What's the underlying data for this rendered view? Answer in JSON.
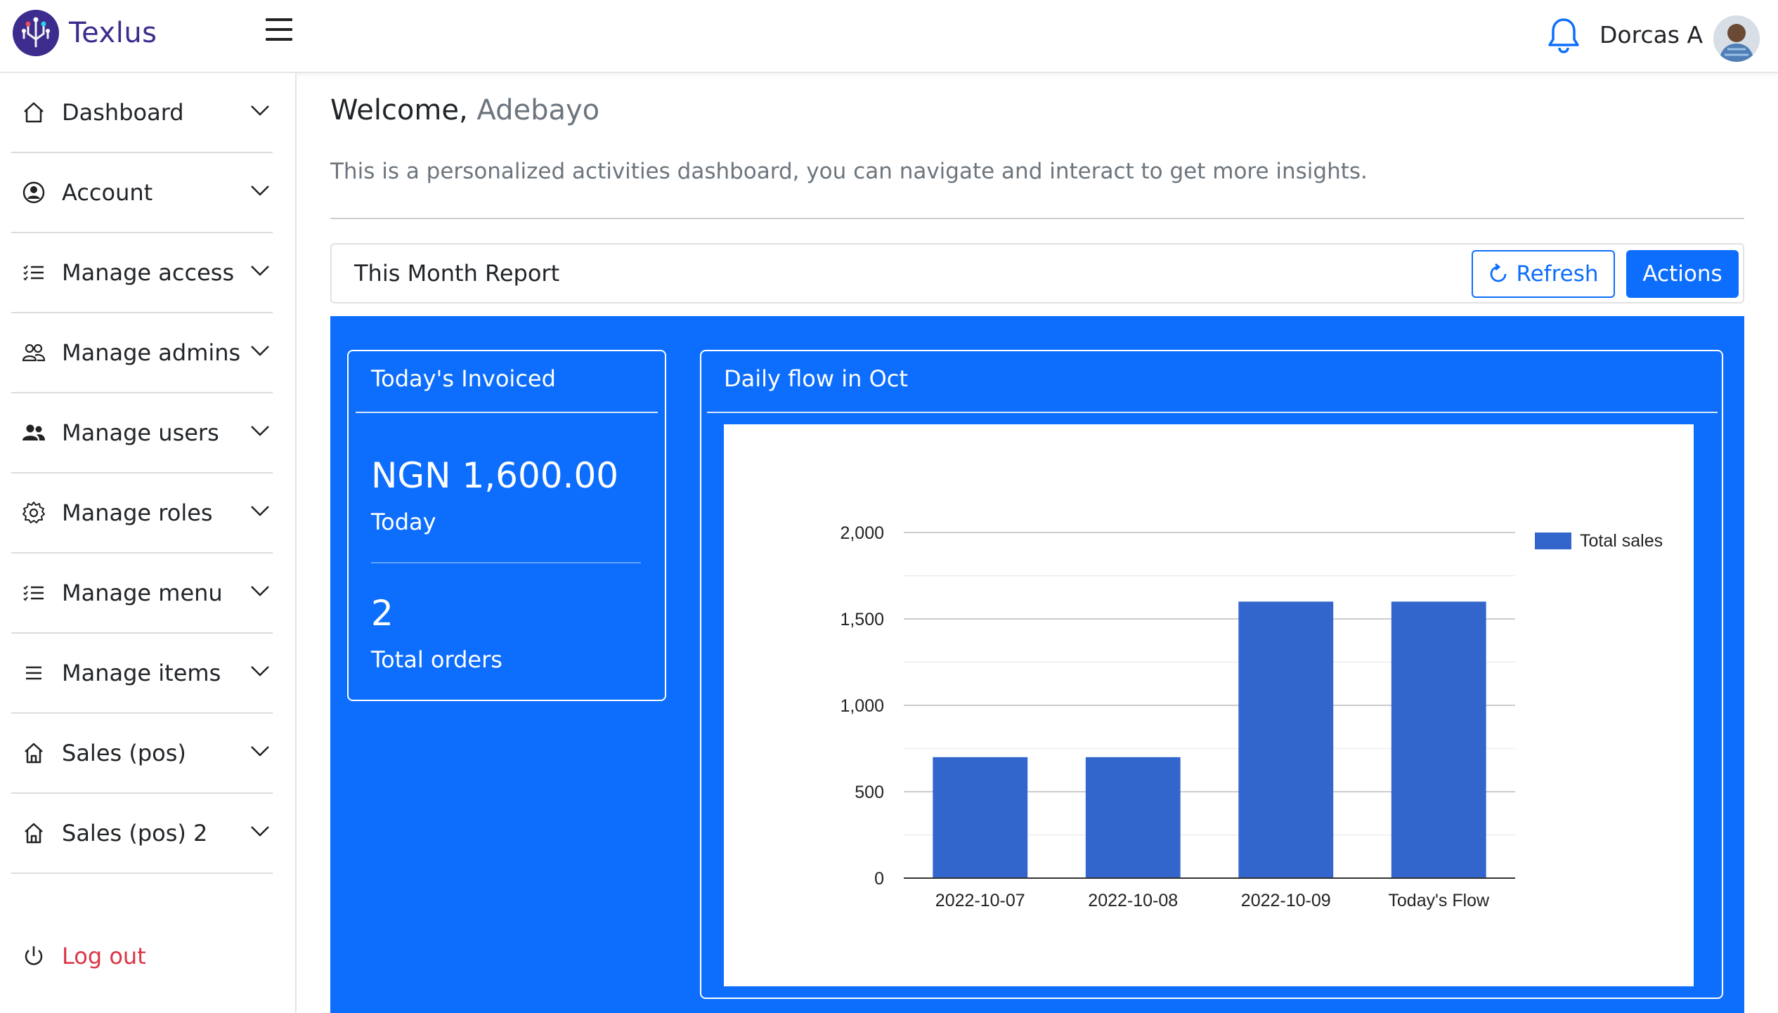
{
  "header": {
    "brand": "Texlus",
    "user_name": "Dorcas A"
  },
  "sidebar": {
    "items": [
      {
        "label": "Dashboard",
        "icon": "home-icon"
      },
      {
        "label": "Account",
        "icon": "user-circle-icon"
      },
      {
        "label": "Manage access",
        "icon": "list-check-icon"
      },
      {
        "label": "Manage admins",
        "icon": "people-outline-icon"
      },
      {
        "label": "Manage users",
        "icon": "people-fill-icon"
      },
      {
        "label": "Manage roles",
        "icon": "gear-icon"
      },
      {
        "label": "Manage menu",
        "icon": "list-check-icon"
      },
      {
        "label": "Manage items",
        "icon": "list-icon"
      },
      {
        "label": "Sales (pos)",
        "icon": "shop-icon"
      },
      {
        "label": "Sales (pos) 2",
        "icon": "shop-icon"
      }
    ],
    "logout_label": "Log out"
  },
  "main": {
    "welcome_prefix": "Welcome,",
    "welcome_name": "Adebayo",
    "subtitle": "This is a personalized activities dashboard, you can navigate and interact to get more insights.",
    "report_title": "This Month Report",
    "refresh_label": "Refresh",
    "actions_label": "Actions",
    "invoice_card": {
      "title": "Today's Invoiced",
      "amount": "NGN 1,600.00",
      "amount_label": "Today",
      "orders": "2",
      "orders_label": "Total orders"
    },
    "chart_card": {
      "title": "Daily flow in Oct"
    }
  },
  "colors": {
    "primary": "#0d6efd",
    "brand": "#3d2c8d",
    "bar": "#3366cc",
    "danger": "#dc3545"
  },
  "chart_data": {
    "type": "bar",
    "categories": [
      "2022-10-07",
      "2022-10-08",
      "2022-10-09",
      "Today's Flow"
    ],
    "series": [
      {
        "name": "Total sales",
        "values": [
          700,
          700,
          1600,
          1600
        ]
      }
    ],
    "ylim": [
      0,
      2000
    ],
    "yticks": [
      0,
      500,
      1000,
      1500,
      2000
    ],
    "ytick_labels": [
      "0",
      "500",
      "1,000",
      "1,500",
      "2,000"
    ],
    "grid": true,
    "legend": "right"
  }
}
